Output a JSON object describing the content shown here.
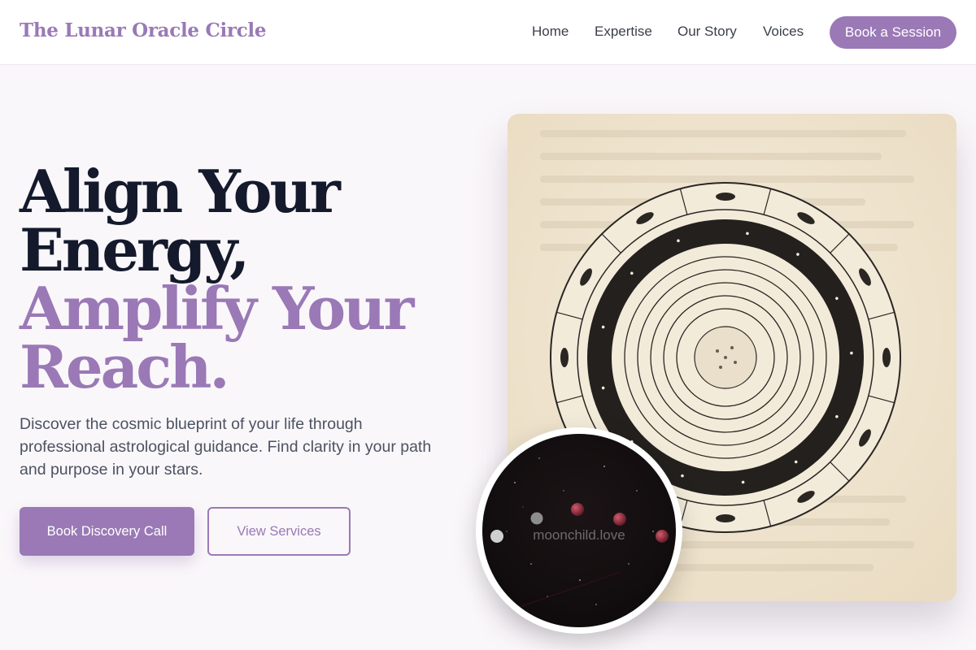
{
  "brand": {
    "name": "The Lunar Oracle Circle"
  },
  "nav": {
    "links": [
      "Home",
      "Expertise",
      "Our Story",
      "Voices"
    ],
    "cta_label": "Book a Session"
  },
  "hero": {
    "headline_dark": [
      "Align Your",
      "Energy,"
    ],
    "headline_accent": [
      "Amplify Your",
      "Reach."
    ],
    "subtext": "Discover the cosmic blueprint of your life through professional astrological guidance. Find clarity in your path and purpose in your stars.",
    "primary_cta": "Book Discovery Call",
    "secondary_cta": "View Services"
  },
  "images": {
    "card_image": "zodiac-wheel-engraving",
    "inset_image": "lunar-eclipse-phases",
    "inset_watermark": "moonchild.love"
  },
  "colors": {
    "accent": "#9a79b6",
    "headline_dark": "#141a2c",
    "background": "#faf7fa",
    "parchment": "#f1e8d6"
  }
}
